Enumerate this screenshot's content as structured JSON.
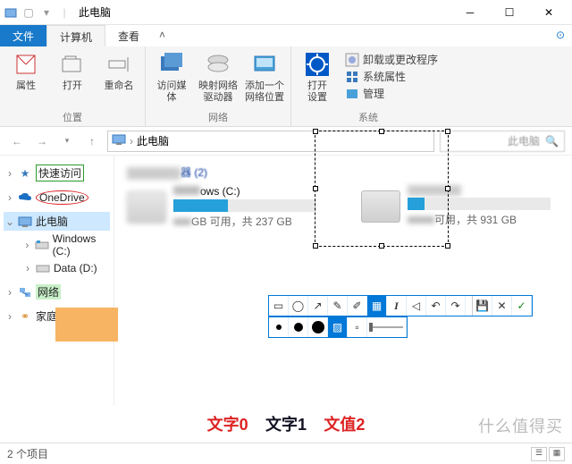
{
  "window": {
    "title": "此电脑"
  },
  "tabs": {
    "file": "文件",
    "computer": "计算机",
    "view": "查看"
  },
  "ribbon": {
    "location": {
      "label": "位置",
      "properties": "属性",
      "open": "打开",
      "rename": "重命名"
    },
    "network": {
      "label": "网络",
      "media": "访问媒体",
      "mapdrive": "映射网络\n驱动器",
      "addloc": "添加一个\n网络位置"
    },
    "system": {
      "label": "系统",
      "opensettings": "打开\n设置",
      "uninstall": "卸载或更改程序",
      "sysprops": "系统属性",
      "manage": "管理"
    }
  },
  "addr": {
    "path": "此电脑",
    "search_hint": "此电脑"
  },
  "tree": {
    "quick": "快速访问",
    "onedrive": "OneDrive",
    "thispc": "此电脑",
    "winc": "Windows (C:)",
    "datad": "Data (D:)",
    "network": "网络",
    "homegroup": "家庭组"
  },
  "content": {
    "group_suffix": "器 (2)",
    "c": {
      "name": "ows (C:)",
      "free": "GB 可用，共 237 GB",
      "fill_pct": 38
    },
    "d": {
      "name": "可用，共 931 GB",
      "fill_pct": 12
    }
  },
  "status": {
    "items": "2 个项目"
  },
  "bottom": {
    "t0": "文字0",
    "t1": "文字1",
    "t2": "文值2"
  },
  "watermark": "什么值得买"
}
